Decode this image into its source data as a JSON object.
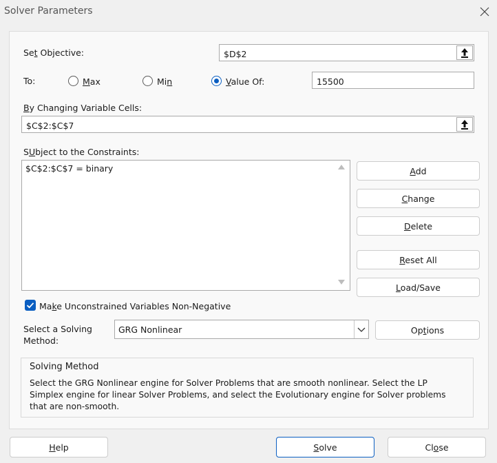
{
  "window": {
    "title": "Solver Parameters",
    "close_icon": "close-icon"
  },
  "objective": {
    "label_pre": "Se",
    "label_key": "t",
    "label_post": " Objective:",
    "value": "$D$2"
  },
  "to": {
    "label": "To:",
    "max_key": "M",
    "max_rest": "ax",
    "min_pre": "Mi",
    "min_key": "n",
    "valueof_key": "V",
    "valueof_rest": "alue Of:",
    "selected": "value_of",
    "value": "15500"
  },
  "changing": {
    "label_key": "B",
    "label_rest": "y Changing Variable Cells:",
    "value": "$C$2:$C$7"
  },
  "constraints": {
    "label_key": "U",
    "label_pre": "S",
    "label_rest": "bject to the Constraints:",
    "items": [
      "$C$2:$C$7 = binary"
    ]
  },
  "buttons": {
    "add_key": "A",
    "add_rest": "dd",
    "change_key": "C",
    "change_rest": "hange",
    "delete_key": "D",
    "delete_rest": "elete",
    "reset_key": "R",
    "reset_rest": "eset All",
    "load_key": "L",
    "load_rest": "oad/Save",
    "options_pre": "Op",
    "options_key": "t",
    "options_rest": "ions",
    "help_key": "H",
    "help_rest": "elp",
    "solve_key": "S",
    "solve_rest": "olve",
    "close_pre": "Cl",
    "close_key": "o",
    "close_rest": "se"
  },
  "nonneg": {
    "pre": "Ma",
    "key": "k",
    "rest": "e Unconstrained Variables Non-Negative",
    "checked": true
  },
  "method": {
    "label_line1": "Select a Solving",
    "label_line2": "Method:",
    "selected": "GRG Nonlinear"
  },
  "solving_method": {
    "title": "Solving Method",
    "description": "Select the GRG Nonlinear engine for Solver Problems that are smooth nonlinear. Select the LP Simplex engine for linear Solver Problems, and select the Evolutionary engine for Solver problems that are non-smooth."
  },
  "colors": {
    "accent": "#0a5ec1",
    "panel": "#f9f9f9",
    "window": "#f0f0f0"
  }
}
